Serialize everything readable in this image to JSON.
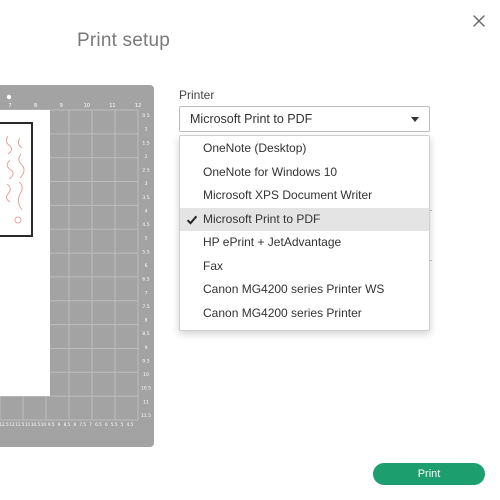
{
  "dialog": {
    "title": "Print setup",
    "close_icon": "close-icon"
  },
  "printer": {
    "label": "Printer",
    "selected": "Microsoft Print to PDF",
    "options": [
      {
        "label": "OneNote (Desktop)",
        "selected": false
      },
      {
        "label": "OneNote for Windows 10",
        "selected": false
      },
      {
        "label": "Microsoft XPS Document Writer",
        "selected": false
      },
      {
        "label": "Microsoft Print to PDF",
        "selected": true
      },
      {
        "label": "HP ePrint + JetAdvantage",
        "selected": false
      },
      {
        "label": "Fax",
        "selected": false
      },
      {
        "label": "Canon MG4200 series Printer WS",
        "selected": false
      },
      {
        "label": "Canon MG4200 series Printer",
        "selected": false
      }
    ]
  },
  "mat": {
    "top_ruler": [
      "7",
      "8",
      "9",
      "10",
      "11",
      "12"
    ],
    "right_ruler": [
      "0.5",
      "1",
      "1.5",
      "2",
      "2.5",
      "3",
      "3.5",
      "4",
      "4.5",
      "5",
      "5.5",
      "6",
      "6.5",
      "7",
      "7.5",
      "8",
      "8.5",
      "9",
      "9.5",
      "10",
      "10.5",
      "11",
      "11.5"
    ],
    "bottom_ruler": [
      "12.5",
      "12",
      "11.5",
      "11",
      "10.5",
      "10",
      "9.5",
      "9",
      "8.5",
      "8",
      "7.5",
      "7",
      "6.5",
      "6",
      "5.5",
      "5",
      "4.5"
    ]
  },
  "actions": {
    "print_label": "Print"
  },
  "colors": {
    "accent": "#1d9e6e",
    "mat": "#a3a3a3",
    "design_stroke": "#e7a3a3"
  }
}
